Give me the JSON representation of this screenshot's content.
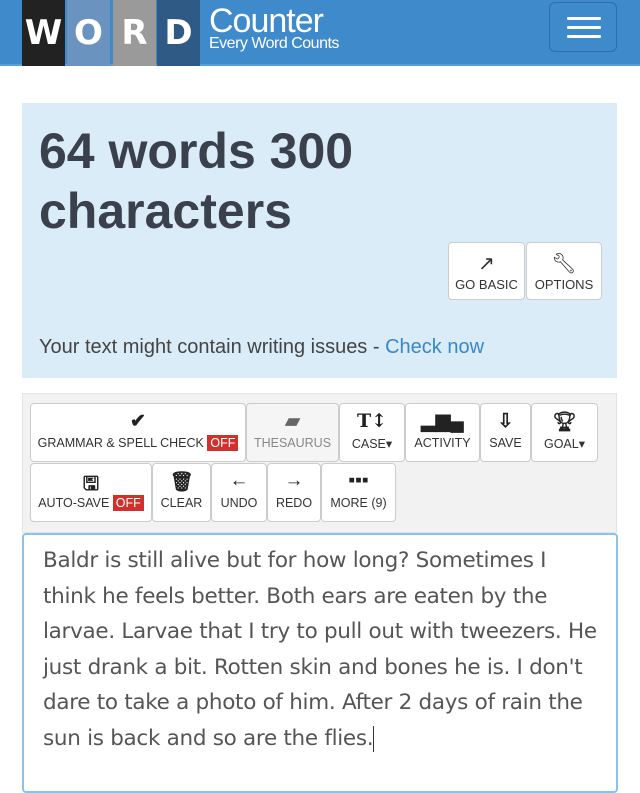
{
  "header": {
    "logo_letters": [
      "W",
      "O",
      "R",
      "D"
    ],
    "logo_colors": [
      "#222222",
      "#6a94bf",
      "#9a9a9a",
      "#2f5a85"
    ],
    "brand": "Counter",
    "tagline": "Every Word Counts",
    "menu_icon": "hamburger-icon"
  },
  "stats": {
    "line1": "64 words 300",
    "line2": "characters",
    "go_basic": "GO BASIC",
    "options": "OPTIONS",
    "issue_text": "Your text might contain writing issues - ",
    "issue_link": "Check now"
  },
  "toolbar": {
    "grammar": "GRAMMAR & SPELL CHECK",
    "grammar_state": "OFF",
    "thesaurus": "THESAURUS",
    "case": "CASE▾",
    "activity": "ACTIVITY",
    "save": "SAVE",
    "goal": "GOAL▾",
    "autosave": "AUTO-SAVE",
    "autosave_state": "OFF",
    "clear": "CLEAR",
    "undo": "UNDO",
    "redo": "REDO",
    "more": "MORE (9)"
  },
  "editor": {
    "text": "Baldr is still alive but for how long? Sometimes I think he feels better. Both ears are eaten by the larvae. Larvae that I try to pull out with tweezers. He just drank a bit. Rotten skin and bones he is. I don't dare to take a photo of him. After 2 days of rain the sun is back and so are the flies."
  },
  "colors": {
    "header": "#3f8acb",
    "stats_bg": "#d9ecf7",
    "off_badge": "#d0312d",
    "link": "#3a87c8"
  }
}
